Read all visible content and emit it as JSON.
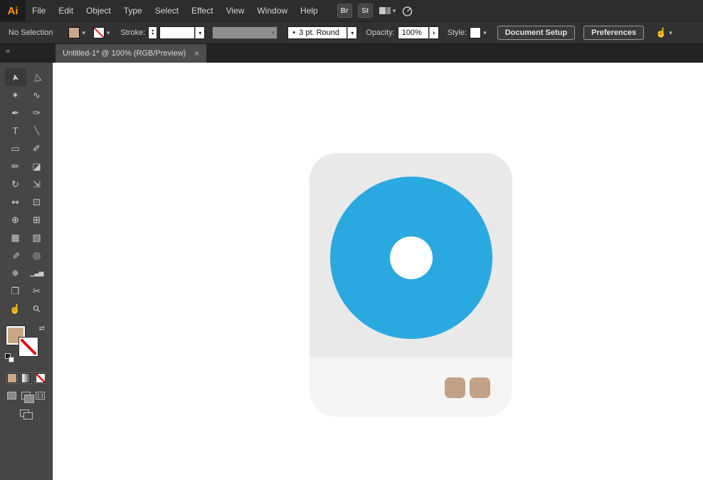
{
  "app": {
    "logo": "Ai"
  },
  "menubar": {
    "menus": [
      "File",
      "Edit",
      "Object",
      "Type",
      "Select",
      "Effect",
      "View",
      "Window",
      "Help"
    ],
    "bridge_label": "Br",
    "stock_label": "St"
  },
  "controlbar": {
    "selection_status": "No Selection",
    "stroke_label": "Stroke:",
    "stroke_weight_value": "",
    "brush_name": "3 pt. Round",
    "opacity_label": "Opacity:",
    "opacity_value": "100%",
    "style_label": "Style:",
    "document_setup_label": "Document Setup",
    "preferences_label": "Preferences"
  },
  "tabbar": {
    "collapse_glyph": "«",
    "title": "Untitled-1* @ 100% (RGB/Preview)",
    "close_glyph": "×"
  },
  "tools": [
    {
      "name": "selection",
      "glyph": "➤"
    },
    {
      "name": "direct-selection",
      "glyph": "▷"
    },
    {
      "name": "magic-wand",
      "glyph": "✶"
    },
    {
      "name": "lasso",
      "glyph": "∿"
    },
    {
      "name": "pen",
      "glyph": "✒"
    },
    {
      "name": "curvature",
      "glyph": "✑"
    },
    {
      "name": "type",
      "glyph": "T"
    },
    {
      "name": "line-segment",
      "glyph": "╲"
    },
    {
      "name": "rectangle",
      "glyph": "▭"
    },
    {
      "name": "paintbrush",
      "glyph": "✐"
    },
    {
      "name": "pencil",
      "glyph": "✏"
    },
    {
      "name": "eraser",
      "glyph": "◪"
    },
    {
      "name": "rotate",
      "glyph": "↻"
    },
    {
      "name": "scale",
      "glyph": "⇲"
    },
    {
      "name": "width",
      "glyph": "↭"
    },
    {
      "name": "free-transform",
      "glyph": "⊡"
    },
    {
      "name": "shape-builder",
      "glyph": "⊕"
    },
    {
      "name": "perspective-grid",
      "glyph": "⊞"
    },
    {
      "name": "mesh",
      "glyph": "▦"
    },
    {
      "name": "gradient",
      "glyph": "▧"
    },
    {
      "name": "eyedropper",
      "glyph": "✎"
    },
    {
      "name": "blend",
      "glyph": "◎"
    },
    {
      "name": "symbol-sprayer",
      "glyph": "✵"
    },
    {
      "name": "column-graph",
      "glyph": "▁▃▅"
    },
    {
      "name": "artboard",
      "glyph": "❐"
    },
    {
      "name": "slice",
      "glyph": "✂"
    },
    {
      "name": "hand",
      "glyph": "☝"
    },
    {
      "name": "zoom",
      "glyph": "⚲"
    }
  ],
  "icons": {
    "chevron_down": "▾",
    "stepper_up": "▴",
    "stepper_down": "▾",
    "opacity_arrow": "›",
    "brush_dot": "•",
    "swap": "⇄",
    "touch_hand": "☝"
  },
  "artwork": {
    "card_color": "#e9e9e9",
    "panel_color": "#f4f4f4",
    "disc_color": "#2aa9e0",
    "hole_color": "#ffffff",
    "button_color": "#c2a186"
  },
  "colors": {
    "ui_dark": "#323232",
    "toolbar_bg": "#464646",
    "logo_orange": "#ff9a00",
    "fill_swatch": "#c9a886",
    "slash_red": "#dd1111"
  }
}
